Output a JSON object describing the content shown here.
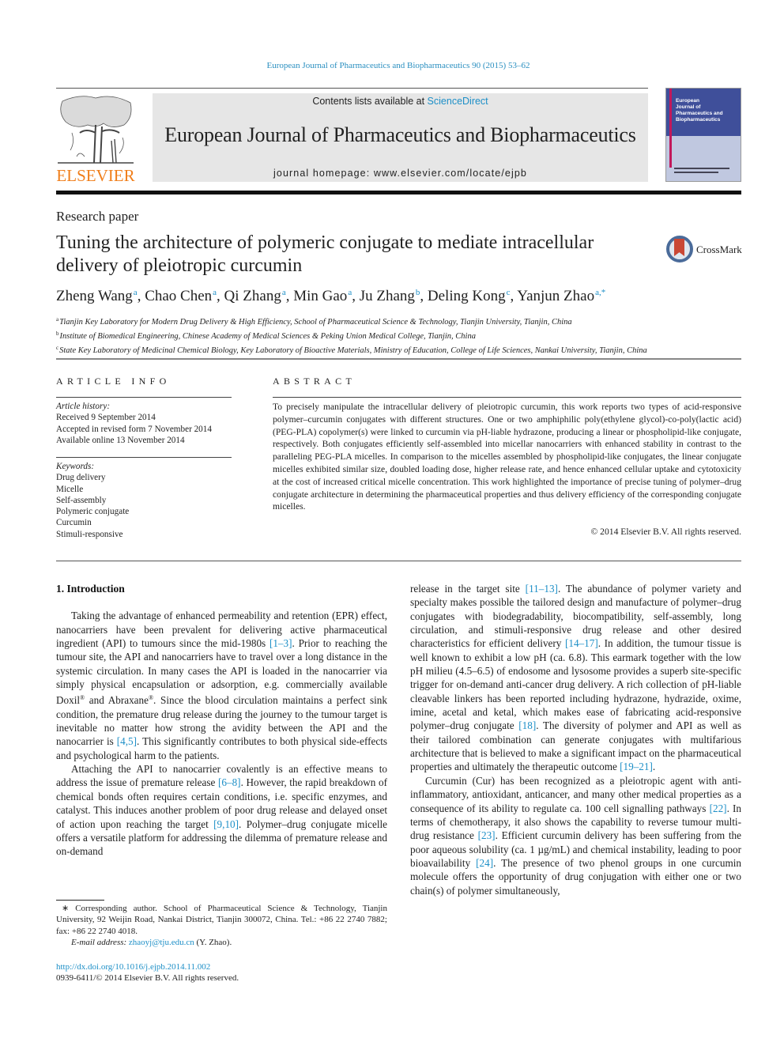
{
  "header": {
    "citation": "European Journal of Pharmaceutics and Biopharmaceutics 90 (2015) 53–62",
    "contents_prefix": "Contents lists available at ",
    "contents_link": "ScienceDirect",
    "journal_title": "European Journal of Pharmaceutics and Biopharmaceutics",
    "homepage": "journal homepage: www.elsevier.com/locate/ejpb",
    "publisher_logo": "ELSEVIER",
    "cover_title_lines": [
      "European",
      "Journal of",
      "Pharmaceutics and",
      "Biopharmaceutics"
    ],
    "crossmark_label": "CrossMark"
  },
  "article": {
    "type": "Research paper",
    "title": "Tuning the architecture of polymeric conjugate to mediate intracellular delivery of pleiotropic curcumin",
    "authors": [
      {
        "name": "Zheng Wang",
        "sup": "a",
        "sep": ", "
      },
      {
        "name": "Chao Chen",
        "sup": "a",
        "sep": ", "
      },
      {
        "name": "Qi Zhang",
        "sup": "a",
        "sep": ", "
      },
      {
        "name": "Min Gao",
        "sup": "a",
        "sep": ", "
      },
      {
        "name": "Ju Zhang",
        "sup": "b",
        "sep": ", "
      },
      {
        "name": "Deling Kong",
        "sup": "c",
        "sep": ", "
      },
      {
        "name": "Yanjun Zhao",
        "sup": "a,*",
        "sep": ""
      }
    ],
    "affiliations": [
      {
        "key": "a",
        "text": "Tianjin Key Laboratory for Modern Drug Delivery & High Efficiency, School of Pharmaceutical Science & Technology, Tianjin University, Tianjin, China"
      },
      {
        "key": "b",
        "text": "Institute of Biomedical Engineering, Chinese Academy of Medical Sciences & Peking Union Medical College, Tianjin, China"
      },
      {
        "key": "c",
        "text": "State Key Laboratory of Medicinal Chemical Biology, Key Laboratory of Bioactive Materials, Ministry of Education, College of Life Sciences, Nankai University, Tianjin, China"
      }
    ]
  },
  "article_info": {
    "heading": "ARTICLE INFO",
    "history_label": "Article history:",
    "history": [
      "Received 9 September 2014",
      "Accepted in revised form 7 November 2014",
      "Available online 13 November 2014"
    ],
    "keywords_label": "Keywords:",
    "keywords": [
      "Drug delivery",
      "Micelle",
      "Self-assembly",
      "Polymeric conjugate",
      "Curcumin",
      "Stimuli-responsive"
    ]
  },
  "abstract": {
    "heading": "ABSTRACT",
    "text": "To precisely manipulate the intracellular delivery of pleiotropic curcumin, this work reports two types of acid-responsive polymer–curcumin conjugates with different structures. One or two amphiphilic poly(ethylene glycol)-co-poly(lactic acid) (PEG-PLA) copolymer(s) were linked to curcumin via pH-liable hydrazone, producing a linear or phospholipid-like conjugate, respectively. Both conjugates efficiently self-assembled into micellar nanocarriers with enhanced stability in contrast to the paralleling PEG-PLA micelles. In comparison to the micelles assembled by phospholipid-like conjugates, the linear conjugate micelles exhibited similar size, doubled loading dose, higher release rate, and hence enhanced cellular uptake and cytotoxicity at the cost of increased critical micelle concentration. This work highlighted the importance of precise tuning of polymer–drug conjugate architecture in determining the pharmaceutical properties and thus delivery efficiency of the corresponding conjugate micelles.",
    "copyright": "© 2014 Elsevier B.V. All rights reserved."
  },
  "body": {
    "section_heading": "1. Introduction",
    "paragraphs": [
      [
        {
          "t": "Taking the advantage of enhanced permeability and retention (EPR) effect, nanocarriers have been prevalent for delivering active pharmaceutical ingredient (API) to tumours since the mid-1980s "
        },
        {
          "ref": "[1–3]"
        },
        {
          "t": ". Prior to reaching the tumour site, the API and nanocarriers have to travel over a long distance in the systemic circulation. In many cases the API is loaded in the nanocarrier via simply physical encapsulation or adsorption, e.g. commercially available Doxil"
        },
        {
          "sup": "®"
        },
        {
          "t": " and Abraxane"
        },
        {
          "sup": "®"
        },
        {
          "t": ". Since the blood circulation maintains a perfect sink condition, the premature drug release during the journey to the tumour target is inevitable no matter how strong the avidity between the API and the nanocarrier is "
        },
        {
          "ref": "[4,5]"
        },
        {
          "t": ". This significantly contributes to both physical side-effects and psychological harm to the patients."
        }
      ],
      [
        {
          "t": "Attaching the API to nanocarrier covalently is an effective means to address the issue of premature release "
        },
        {
          "ref": "[6–8]"
        },
        {
          "t": ". However, the rapid breakdown of chemical bonds often requires certain conditions, i.e. specific enzymes, and catalyst. This induces another problem of poor drug release and delayed onset of action upon reaching the target "
        },
        {
          "ref": "[9,10]"
        },
        {
          "t": ". Polymer–drug conjugate micelle offers a versatile platform for addressing the dilemma of premature release and on-demand"
        }
      ]
    ],
    "right_paragraphs": [
      [
        {
          "t": "release in the target site "
        },
        {
          "ref": "[11–13]"
        },
        {
          "t": ". The abundance of polymer variety and specialty makes possible the tailored design and manufacture of polymer–drug conjugates with biodegradability, biocompatibility, self-assembly, long circulation, and stimuli-responsive drug release and other desired characteristics for efficient delivery "
        },
        {
          "ref": "[14–17]"
        },
        {
          "t": ". In addition, the tumour tissue is well known to exhibit a low pH (ca. 6.8). This earmark together with the low pH milieu (4.5–6.5) of endosome and lysosome provides a superb site-specific trigger for on-demand anti-cancer drug delivery. A rich collection of pH-liable cleavable linkers has been reported including hydrazone, hydrazide, oxime, imine, acetal and ketal, which makes ease of fabricating acid-responsive polymer–drug conjugate "
        },
        {
          "ref": "[18]"
        },
        {
          "t": ". The diversity of polymer and API as well as their tailored combination can generate conjugates with multifarious architecture that is believed to make a significant impact on the pharmaceutical properties and ultimately the therapeutic outcome "
        },
        {
          "ref": "[19–21]"
        },
        {
          "t": "."
        }
      ],
      [
        {
          "t": "Curcumin (Cur) has been recognized as a pleiotropic agent with anti-inflammatory, antioxidant, anticancer, and many other medical properties as a consequence of its ability to regulate ca. 100 cell signalling pathways "
        },
        {
          "ref": "[22]"
        },
        {
          "t": ". In terms of chemotherapy, it also shows the capability to reverse tumour multi-drug resistance "
        },
        {
          "ref": "[23]"
        },
        {
          "t": ". Efficient curcumin delivery has been suffering from the poor aqueous solubility (ca. 1 µg/mL) and chemical instability, leading to poor bioavailability "
        },
        {
          "ref": "[24]"
        },
        {
          "t": ". The presence of two phenol groups in one curcumin molecule offers the opportunity of drug conjugation with either one or two chain(s) of polymer simultaneously,"
        }
      ]
    ]
  },
  "footnote": {
    "corresponding": "∗ Corresponding author. School of Pharmaceutical Science & Technology, Tianjin University, 92 Weijin Road, Nankai District, Tianjin 300072, China. Tel.: +86 22 2740 7882; fax: +86 22 2740 4018.",
    "email_label": "E-mail address: ",
    "email": "zhaoyj@tju.edu.cn",
    "email_suffix": " (Y. Zhao).",
    "doi": "http://dx.doi.org/10.1016/j.ejpb.2014.11.002",
    "issn_line": "0939-6411/© 2014 Elsevier B.V. All rights reserved."
  },
  "colors": {
    "link": "#1d8fc7",
    "elsevier_orange": "#f07e1a",
    "banner_gray": "#e6e6e6",
    "cover_blue": "#3f4f9a",
    "cover_magenta": "#c2185b"
  }
}
